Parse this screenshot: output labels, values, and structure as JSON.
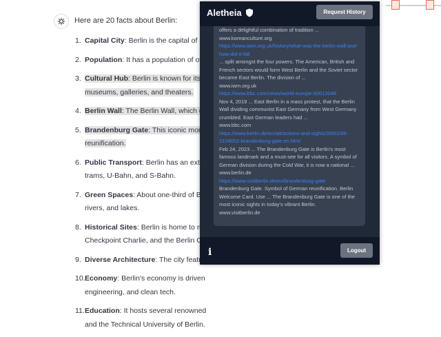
{
  "chat": {
    "intro": "Here are 20 facts about Berlin:",
    "facts": [
      {
        "num": "1.",
        "title": "Capital City",
        "text": ": Berlin is the capital of Ge",
        "highlight": false
      },
      {
        "num": "2.",
        "title": "Population",
        "text": ": It has a population of ove",
        "highlight": false
      },
      {
        "num": "3.",
        "title": "Cultural Hub",
        "text": ": Berlin is known for its v",
        "cont": "museums, galleries, and theaters.",
        "highlight": true
      },
      {
        "num": "4.",
        "title": "Berlin Wall",
        "text": ": The Berlin Wall, which div",
        "highlight": true
      },
      {
        "num": "5.",
        "title": "Brandenburg Gate",
        "text": ": This iconic monum",
        "cont": "reunification.",
        "highlight": true
      },
      {
        "num": "6.",
        "title": "Public Transport",
        "text": ": Berlin has an extens",
        "cont": "trams, U-Bahn, and S-Bahn.",
        "highlight": false
      },
      {
        "num": "7.",
        "title": "Green Spaces",
        "text": ": About one-third of Be",
        "cont": "rivers, and lakes.",
        "highlight": false
      },
      {
        "num": "8.",
        "title": "Historical Sites",
        "text": ": Berlin is home to mar",
        "cont": "Checkpoint Charlie, and the Berlin Ca",
        "highlight": false
      },
      {
        "num": "9.",
        "title": "Diverse Architecture",
        "text": ": The city feature",
        "highlight": false
      },
      {
        "num": "10.",
        "title": "Economy",
        "text": ": Berlin's economy is driven",
        "cont": "engineering, and clean tech.",
        "highlight": false
      },
      {
        "num": "11.",
        "title": "Education",
        "text": ": It hosts several renowned",
        "cont": "and the Technical University of Berlin.",
        "highlight": false
      }
    ]
  },
  "popup": {
    "brand": "Aletheia",
    "request_history_label": "Request History",
    "info_label": "i",
    "logout_label": "Logout",
    "results": [
      {
        "type": "text",
        "value": "offers a delightful combination of tradition ..."
      },
      {
        "type": "text",
        "value": "www.koreanculture.org"
      },
      {
        "type": "link",
        "value": "https://www.iwm.org.uk/history/what-was-the-berlin-wall-and-how-did-it-fall"
      },
      {
        "type": "text",
        "value": "... split amongst the four powers. The American, British and French sectors would form West Berlin and the Soviet sector became East Berlin. The division of ..."
      },
      {
        "type": "text",
        "value": "www.iwm.org.uk"
      },
      {
        "type": "link",
        "value": "https://www.bbc.com/news/world-europe-50013048"
      },
      {
        "type": "text",
        "value": "Nov 4, 2019 ... East Berlin in a mass protest, that the Berlin Wall dividing communist East Germany from West Germany crumbled. East German leaders had ..."
      },
      {
        "type": "text",
        "value": "www.bbc.com"
      },
      {
        "type": "link",
        "value": "https://www.berlin.de/en/attractions-and-sights/3560266-3104052-brandenburg-gate.en.html"
      },
      {
        "type": "text",
        "value": "Feb 24, 2023 ... The Brandenburg Gate is Berlin's most famous landmark and a must-see for all visitors. A symbol of German division during the Cold War, it is now a national ..."
      },
      {
        "type": "text",
        "value": "www.berlin.de"
      },
      {
        "type": "link",
        "value": "https://www.visitberlin.de/en/brandenburg-gate"
      },
      {
        "type": "text",
        "value": "Brandenburg Gate. Symbol of German reunification. Berlin Welcome Card. Use ... The Brandenburg Gate is one of the most iconic sights in today's vibrant Berlin."
      },
      {
        "type": "text",
        "value": "www.visitberlin.de"
      }
    ]
  },
  "colors": {
    "popup_bg": "#1f2937",
    "header_bg": "#111827",
    "results_bg": "#374151",
    "button_bg": "#6b7280",
    "link": "#3b82f6",
    "highlight": "#e3e3e3"
  },
  "icons": {
    "bot_avatar": "openai-logo-icon",
    "brand": "shield-icon"
  }
}
